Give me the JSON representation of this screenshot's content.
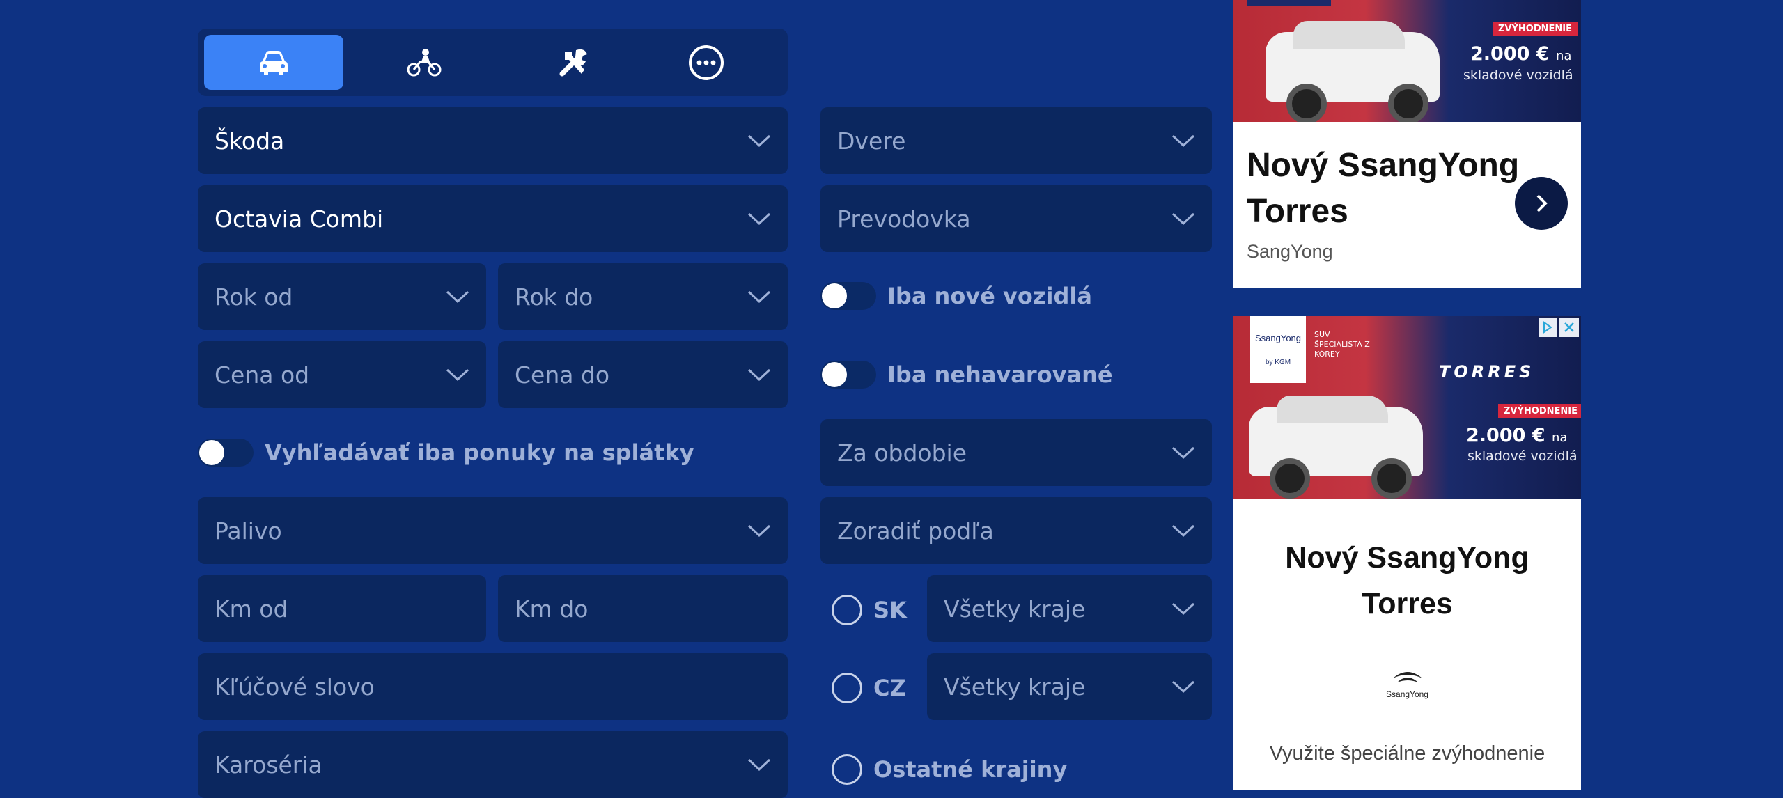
{
  "colors": {
    "background": "#0e3283",
    "field": "#0b275f",
    "tab_active": "#3b82f6",
    "ad_badge": "#d7263d"
  },
  "tabs": [
    {
      "icon": "car-icon",
      "active": true
    },
    {
      "icon": "motorcycle-icon",
      "active": false
    },
    {
      "icon": "tools-icon",
      "active": false
    },
    {
      "icon": "more-icon",
      "active": false
    }
  ],
  "left": {
    "brand": "Škoda",
    "model": "Octavia Combi",
    "year_from": "Rok od",
    "year_to": "Rok do",
    "price_from": "Cena od",
    "price_to": "Cena do",
    "installments_toggle": "Vyhľadávať iba ponuky na splátky",
    "fuel": "Palivo",
    "km_from": "Km od",
    "km_to": "Km do",
    "keyword": "Kľúčové slovo",
    "body": "Karoséria"
  },
  "right": {
    "doors": "Dvere",
    "transmission": "Prevodovka",
    "new_only_toggle": "Iba nové vozidlá",
    "undamaged_toggle": "Iba nehavarované",
    "period": "Za obdobie",
    "sort": "Zoradiť podľa",
    "sk_label": "SK",
    "sk_region": "Všetky kraje",
    "cz_label": "CZ",
    "cz_region": "Všetky kraje",
    "other_label": "Ostatné krajiny"
  },
  "ad1": {
    "badge": "ZVÝHODNENIE",
    "price": "2.000 €",
    "price_suffix": "na",
    "price_sub": "skladové vozidlá",
    "title": "Nový SsangYong Torres",
    "advertiser": "SangYong"
  },
  "ad2": {
    "logo": "SsangYong",
    "logo_sub": "by KGM",
    "tagline": "SUV ŠPECIALISTA Z KÓREY",
    "model_word": "TORRES",
    "badge": "ZVÝHODNENIE",
    "price": "2.000 €",
    "price_suffix": "na",
    "price_sub": "skladové vozidlá",
    "title_line1": "Nový SsangYong",
    "title_line2": "Torres",
    "brand_logo": "SsangYong",
    "body": "Využite špeciálne zvýhodnenie"
  }
}
